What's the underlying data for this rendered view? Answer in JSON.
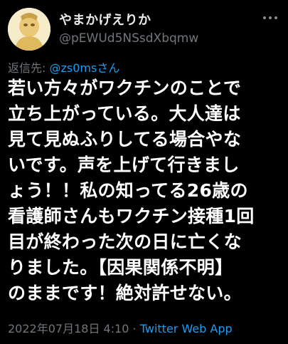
{
  "user": {
    "display_name": "やまかげえりか",
    "handle": "@pEWUd5NSsdXbqmw",
    "avatar_icon": "avatar-image"
  },
  "reply": {
    "label": "返信先: ",
    "mention": "@zs0msさん"
  },
  "tweet": {
    "lines": [
      "若い方々がワクチンのことで",
      "立ち上がっている。大人達は",
      "見て見ぬふりしてる場合やな",
      "いです。声を上げて行きまし",
      "ょう！！私の知ってる26歳の",
      "看護師さんもワクチン接種1回",
      "目が終わった次の日に亡くな",
      "りました。【因果関係不明】",
      "のままです！絶対許せない。"
    ]
  },
  "meta": {
    "timestamp": "2022年07月18日 4:10",
    "separator": " · ",
    "source": "Twitter Web App"
  },
  "colors": {
    "background": "#000000",
    "text": "#ffffff",
    "secondary": "#71767b",
    "link": "#1d9bf0"
  }
}
